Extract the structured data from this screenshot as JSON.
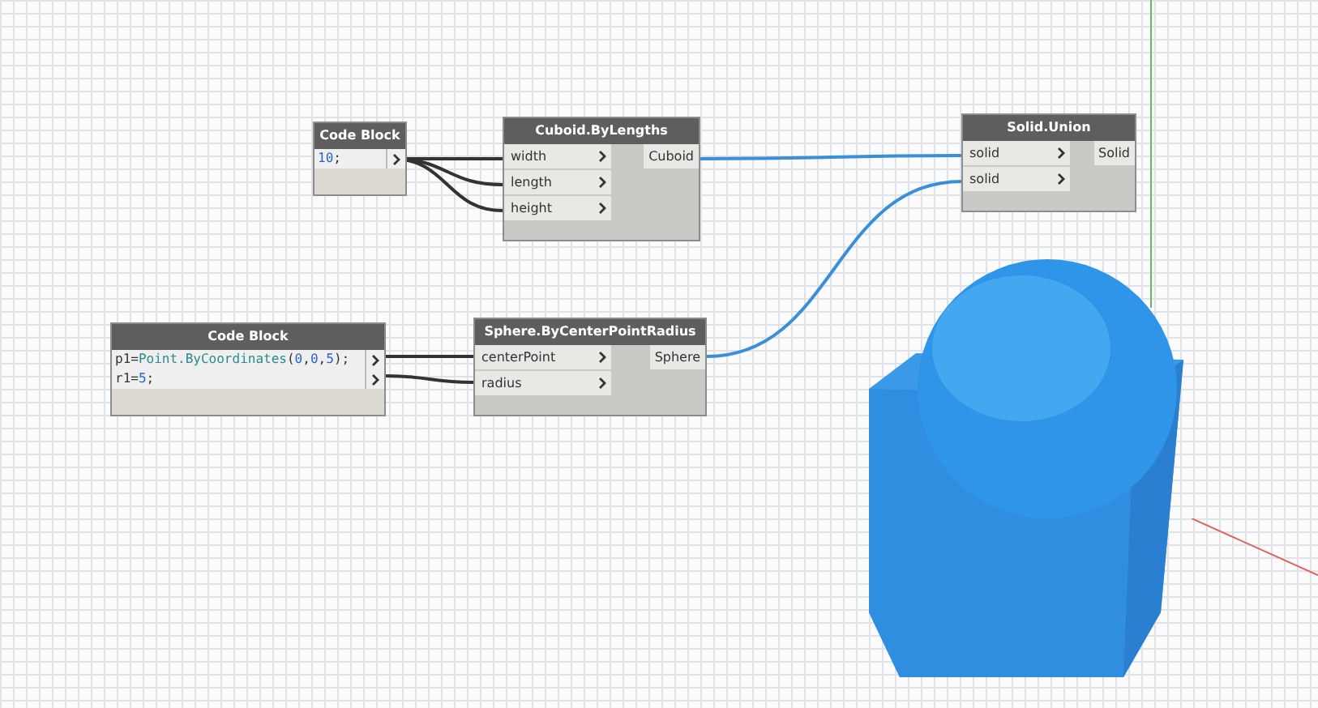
{
  "nodes": [
    {
      "kind": "code",
      "title": "Code Block",
      "code": [
        [
          {
            "kind": "number",
            "text": "10"
          },
          {
            "kind": "plain",
            "text": ";"
          }
        ]
      ]
    },
    {
      "kind": "function",
      "title": "Cuboid.ByLengths",
      "inputs": [
        "width",
        "length",
        "height"
      ],
      "outputs": [
        "Cuboid"
      ]
    },
    {
      "kind": "function",
      "title": "Solid.Union",
      "inputs": [
        "solid",
        "solid"
      ],
      "outputs": [
        "Solid"
      ]
    },
    {
      "kind": "code",
      "title": "Code Block",
      "code": [
        [
          {
            "kind": "plain",
            "text": "p1="
          },
          {
            "kind": "type",
            "text": "Point.ByCoordinates"
          },
          {
            "kind": "plain",
            "text": "("
          },
          {
            "kind": "number",
            "text": "0"
          },
          {
            "kind": "plain",
            "text": ","
          },
          {
            "kind": "number",
            "text": "0"
          },
          {
            "kind": "plain",
            "text": ","
          },
          {
            "kind": "number",
            "text": "5"
          },
          {
            "kind": "plain",
            "text": ");"
          }
        ],
        [
          {
            "kind": "plain",
            "text": "r1="
          },
          {
            "kind": "number",
            "text": "5"
          },
          {
            "kind": "plain",
            "text": ";"
          }
        ]
      ]
    },
    {
      "kind": "function",
      "title": "Sphere.ByCenterPointRadius",
      "inputs": [
        "centerPoint",
        "radius"
      ],
      "outputs": [
        "Sphere"
      ]
    }
  ]
}
